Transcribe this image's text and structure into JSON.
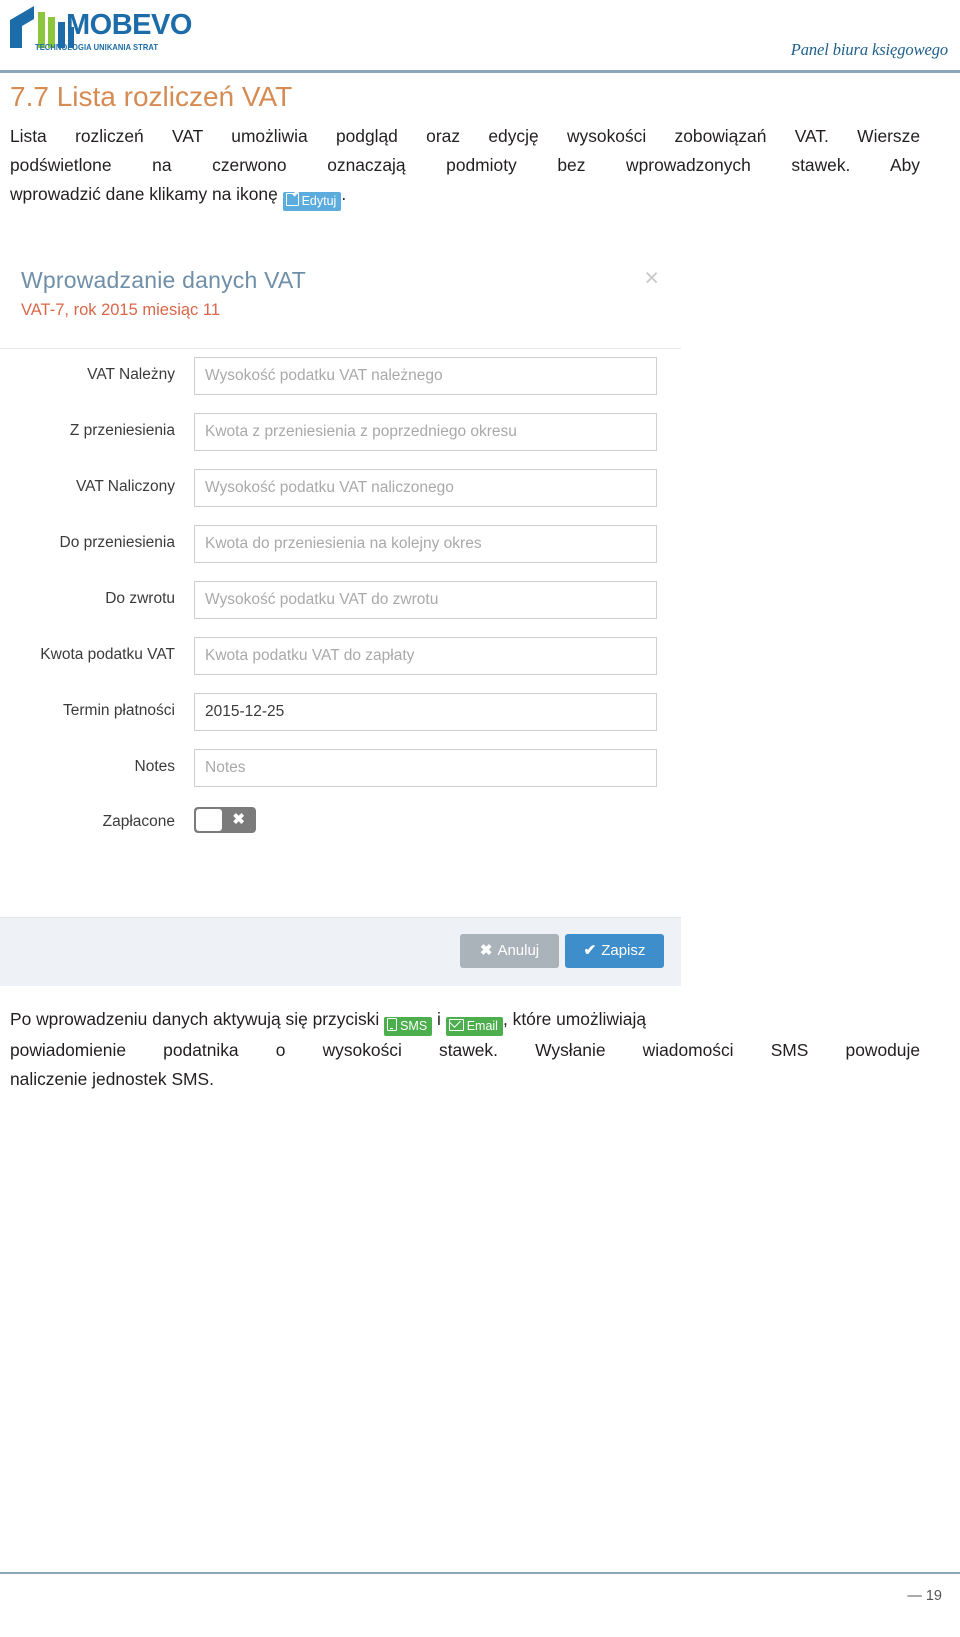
{
  "header": {
    "logo_text": "MOBEVO",
    "logo_tagline": "TECHNOLOGIA UNIKANIA STRAT",
    "right_title": "Panel biura księgowego",
    "brand_blue": "#1b6ca8",
    "brand_green": "#8cc63f"
  },
  "section": {
    "heading": "7.7 Lista rozliczeń VAT",
    "heading_color": "#d68b52",
    "paragraph_top": {
      "line1": "Lista rozliczeń VAT umożliwia podgląd oraz edycję wysokości zobowiązań VAT. Wiersze",
      "line2": "podświetlone  na  czerwono  oznaczają  podmioty  bez  wprowadzonych  stawek.  Aby",
      "line3_before": "wprowadzić dane klikamy na ikonę ",
      "line3_after": "."
    },
    "paragraph_bottom": {
      "line1_before": "Po  wprowadzeniu  danych  aktywują  się  przyciski ",
      "line1_mid": " i ",
      "line1_after": ", które  umożliwiają",
      "line2": "powiadomienie podatnika o wysokości stawek. Wysłanie wiadomości SMS powoduje",
      "line3": "naliczenie jednostek SMS."
    }
  },
  "inline_buttons": {
    "edytuj": {
      "label": "Edytuj",
      "icon": "edit-icon",
      "color": "#5cadde"
    },
    "sms": {
      "label": "SMS",
      "icon": "sms-icon",
      "color": "#4cae4c"
    },
    "email": {
      "label": "Email",
      "icon": "email-icon",
      "color": "#4cae4c"
    }
  },
  "modal": {
    "title": "Wprowadzanie danych VAT",
    "subtitle": "VAT-7, rok 2015 miesiąc 11",
    "close_icon": "close-icon",
    "close_glyph": "×",
    "fields": [
      {
        "label": "VAT Należny",
        "placeholder": "Wysokość podatku VAT należnego",
        "value": ""
      },
      {
        "label": "Z przeniesienia",
        "placeholder": "Kwota z przeniesienia z poprzedniego okresu",
        "value": ""
      },
      {
        "label": "VAT Naliczony",
        "placeholder": "Wysokość podatku VAT naliczonego",
        "value": ""
      },
      {
        "label": "Do przeniesienia",
        "placeholder": "Kwota do przeniesienia na kolejny okres",
        "value": ""
      },
      {
        "label": "Do zwrotu",
        "placeholder": "Wysokość podatku VAT do zwrotu",
        "value": ""
      },
      {
        "label": "Kwota podatku VAT",
        "placeholder": "Kwota podatku VAT do zapłaty",
        "value": ""
      },
      {
        "label": "Termin płatności",
        "placeholder": "",
        "value": "2015-12-25"
      },
      {
        "label": "Notes",
        "placeholder": "Notes",
        "value": ""
      }
    ],
    "toggle": {
      "label": "Zapłacone",
      "state": "off",
      "off_glyph": "✖"
    },
    "footer": {
      "cancel_label": "Anuluj",
      "cancel_mark": "✖",
      "cancel_color": "#aab2ba",
      "save_label": "Zapisz",
      "save_mark": "✔",
      "save_color": "#3e8ecb"
    }
  },
  "page_footer": {
    "page_number": "— 19"
  }
}
